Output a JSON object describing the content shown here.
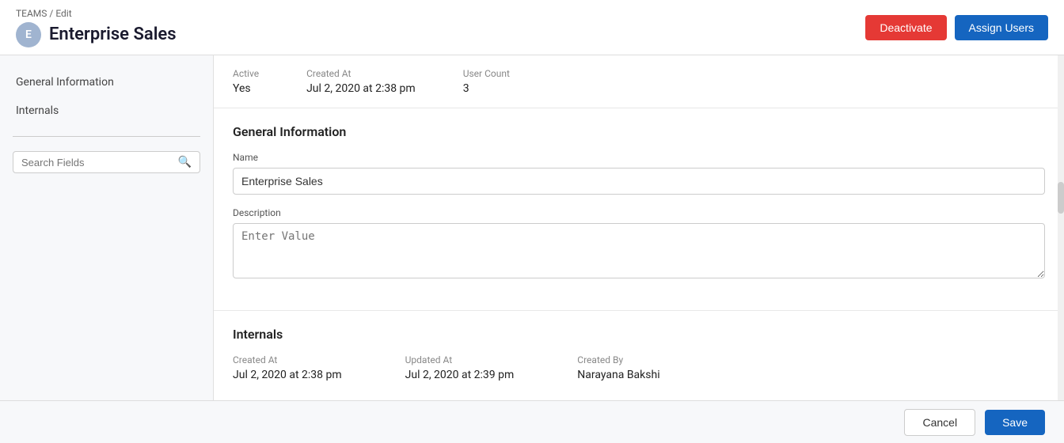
{
  "header": {
    "breadcrumb": "TEAMS / Edit",
    "title": "Enterprise Sales",
    "avatar_letter": "E",
    "deactivate_label": "Deactivate",
    "assign_users_label": "Assign Users"
  },
  "sidebar": {
    "nav_items": [
      {
        "label": "General Information",
        "id": "general-information"
      },
      {
        "label": "Internals",
        "id": "internals"
      }
    ],
    "search_placeholder": "Search Fields"
  },
  "stats": {
    "active_label": "Active",
    "active_value": "Yes",
    "created_at_label": "Created At",
    "created_at_value": "Jul 2, 2020 at 2:38 pm",
    "user_count_label": "User Count",
    "user_count_value": "3"
  },
  "general_information": {
    "section_title": "General Information",
    "name_label": "Name",
    "name_value": "Enterprise Sales",
    "description_label": "Description",
    "description_placeholder": "Enter Value"
  },
  "internals": {
    "section_title": "Internals",
    "created_at_label": "Created At",
    "created_at_value": "Jul 2, 2020 at 2:38 pm",
    "updated_at_label": "Updated At",
    "updated_at_value": "Jul 2, 2020 at 2:39 pm",
    "created_by_label": "Created By",
    "created_by_value": "Narayana Bakshi"
  },
  "footer": {
    "cancel_label": "Cancel",
    "save_label": "Save"
  }
}
